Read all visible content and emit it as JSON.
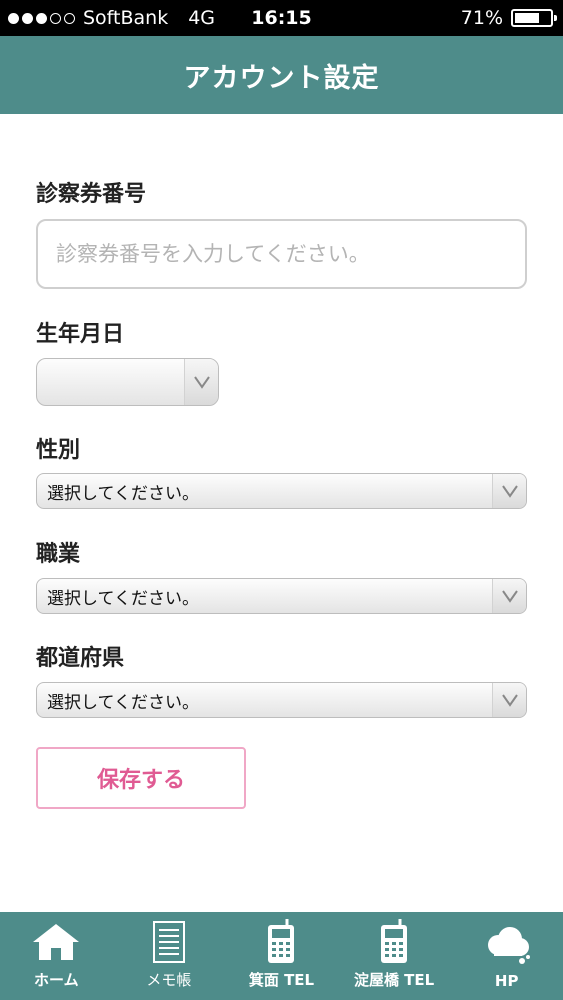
{
  "status_bar": {
    "carrier": "SoftBank",
    "network": "4G",
    "time": "16:15",
    "battery_text": "71%",
    "battery_level": 0.71
  },
  "nav": {
    "title": "アカウント設定"
  },
  "form": {
    "card_number": {
      "label": "診察券番号",
      "value": "",
      "placeholder": "診察券番号を入力してください。"
    },
    "birthdate": {
      "label": "生年月日",
      "value": ""
    },
    "gender": {
      "label": "性別",
      "value": "選択してください。"
    },
    "occupation": {
      "label": "職業",
      "value": "選択してください。"
    },
    "prefecture": {
      "label": "都道府県",
      "value": "選択してください。"
    },
    "save_label": "保存する"
  },
  "tabs": [
    {
      "label": "ホーム",
      "icon": "home-icon"
    },
    {
      "label": "メモ帳",
      "icon": "notepad-icon"
    },
    {
      "label": "箕面 TEL",
      "icon": "phone-icon"
    },
    {
      "label": "淀屋橋 TEL",
      "icon": "phone-icon"
    },
    {
      "label": "HP",
      "icon": "cloud-icon"
    }
  ],
  "colors": {
    "header": "#4e8c8a",
    "save_accent": "#e05b93"
  }
}
